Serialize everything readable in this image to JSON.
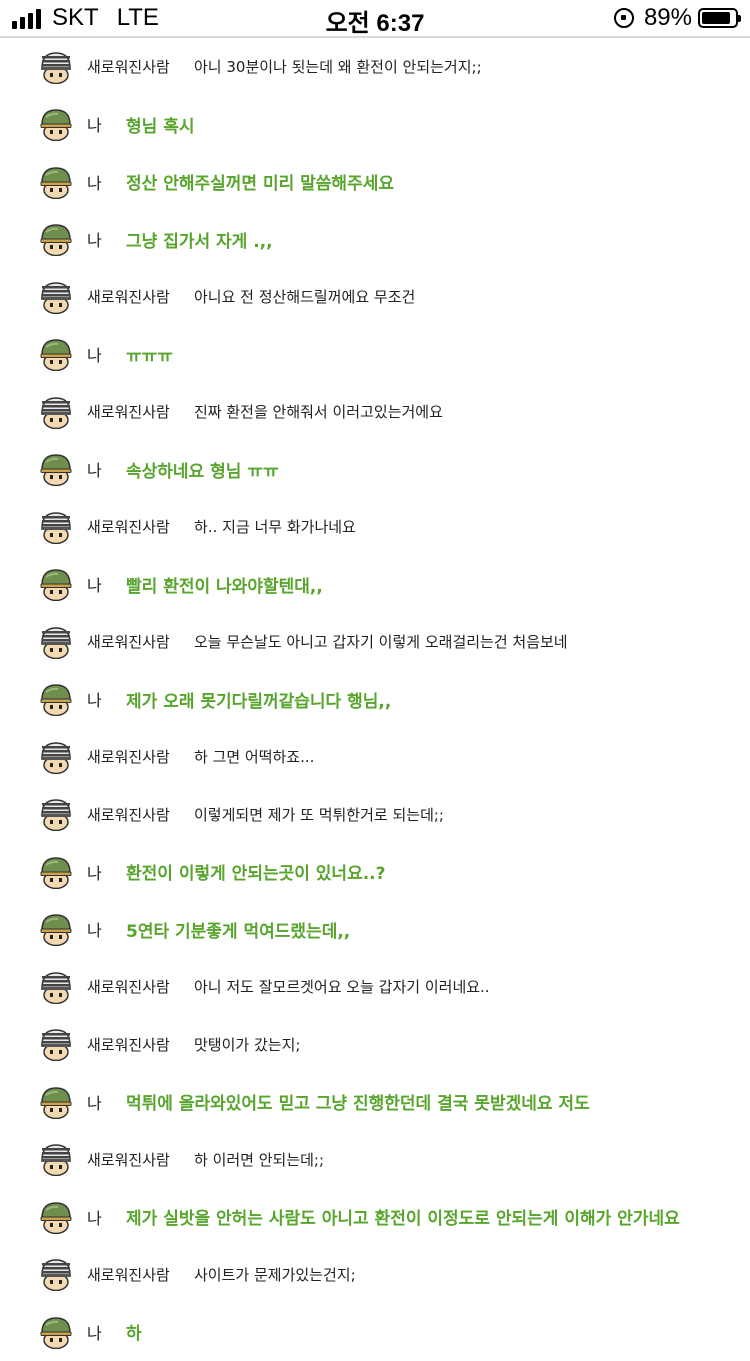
{
  "status_bar": {
    "carrier": "SKT",
    "network": "LTE",
    "time": "오전 6:37",
    "battery": "89%",
    "battery_level": 0.89
  },
  "icons": {
    "avatar_other": "striped-helmet-soldier-icon",
    "avatar_me": "green-helmet-soldier-icon"
  },
  "colors": {
    "my_message": "#58a52d",
    "other_message": "#222222"
  },
  "messages": [
    {
      "me": false,
      "sender": "새로워진사람",
      "text": "아니 30분이나 됫는데 왜 환전이 안되는거지;;"
    },
    {
      "me": true,
      "sender": "나",
      "text": "형님 혹시"
    },
    {
      "me": true,
      "sender": "나",
      "text": "정산 안해주실꺼면 미리 말씀해주세요"
    },
    {
      "me": true,
      "sender": "나",
      "text": "그냥 집가서 자게 .,,"
    },
    {
      "me": false,
      "sender": "새로워진사람",
      "text": "아니요 전 정산해드릴꺼에요 무조건"
    },
    {
      "me": true,
      "sender": "나",
      "text": "ㅠㅠㅠ"
    },
    {
      "me": false,
      "sender": "새로워진사람",
      "text": "진짜 환전을 안해줘서 이러고있는거에요"
    },
    {
      "me": true,
      "sender": "나",
      "text": "속상하네요 형님 ㅠㅠ"
    },
    {
      "me": false,
      "sender": "새로워진사람",
      "text": "하.. 지금 너무 화가나네요"
    },
    {
      "me": true,
      "sender": "나",
      "text": "빨리 환전이 나와야할텐대,,"
    },
    {
      "me": false,
      "sender": "새로워진사람",
      "text": "오늘 무슨날도 아니고 갑자기 이렇게 오래걸리는건 처음보네"
    },
    {
      "me": true,
      "sender": "나",
      "text": "제가 오래 못기다릴꺼같습니다 행님,,"
    },
    {
      "me": false,
      "sender": "새로워진사람",
      "text": "하 그면 어떡하죠..."
    },
    {
      "me": false,
      "sender": "새로워진사람",
      "text": "이렇게되면 제가 또 먹튀한거로 되는데;;"
    },
    {
      "me": true,
      "sender": "나",
      "text": "환전이 이렇게 안되는곳이 있너요..?"
    },
    {
      "me": true,
      "sender": "나",
      "text": "5연타 기분좋게 먹여드랬는데,,"
    },
    {
      "me": false,
      "sender": "새로워진사람",
      "text": "아니 저도 잘모르겟어요 오늘 갑자기 이러네요.."
    },
    {
      "me": false,
      "sender": "새로워진사람",
      "text": "맛탱이가 갔는지;"
    },
    {
      "me": true,
      "sender": "나",
      "text": "먹튀에 올라와있어도 믿고 그냥 진행한던데 결국 못받겠네요 저도"
    },
    {
      "me": false,
      "sender": "새로워진사람",
      "text": "하 이러면 안되는데;;"
    },
    {
      "me": true,
      "sender": "나",
      "text": "제가 실밧을 안허는 사람도 아니고 환전이 이정도로 안되는게 이해가 안가네요"
    },
    {
      "me": false,
      "sender": "새로워진사람",
      "text": "사이트가 문제가있는건지;"
    },
    {
      "me": true,
      "sender": "나",
      "text": "하"
    }
  ]
}
